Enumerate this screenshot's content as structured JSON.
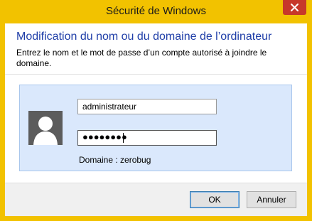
{
  "window": {
    "title": "Sécurité de Windows"
  },
  "dialog": {
    "heading": "Modification du nom ou du domaine de l’ordinateur",
    "description": "Entrez le nom et le mot de passe d’un compte autorisé à joindre le domaine."
  },
  "credentials": {
    "username_value": "administrateur",
    "password_masked": "●●●●●●●●",
    "domain_label": "Domaine : zerobug"
  },
  "buttons": {
    "ok_label": "OK",
    "cancel_label": "Annuler"
  },
  "colors": {
    "titlebar": "#f2c200",
    "close_button": "#c7382a",
    "heading_text": "#1f3ea8",
    "panel_background": "#dae8fc"
  }
}
